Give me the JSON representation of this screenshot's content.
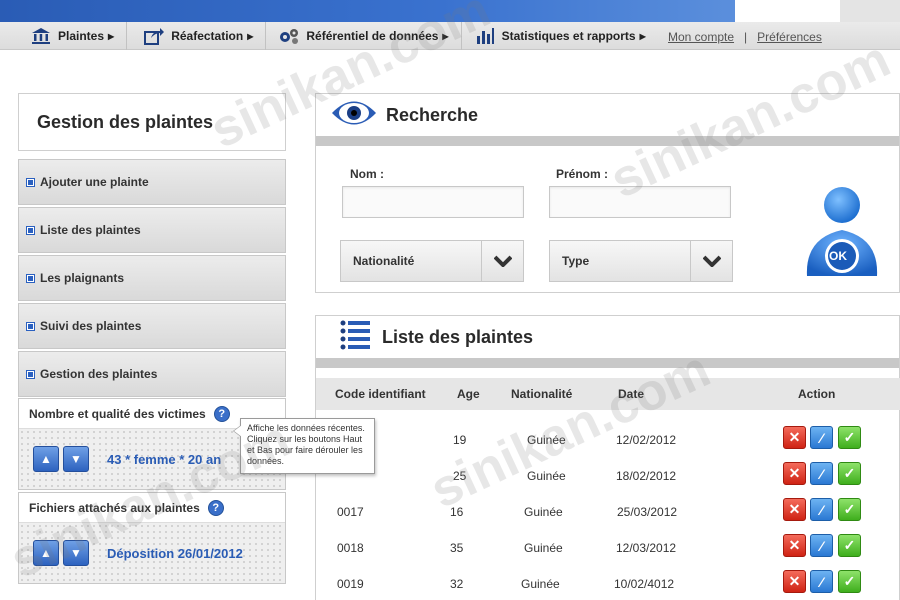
{
  "nav": {
    "menu": [
      {
        "label": "Plaintes",
        "icon": "bank-icon"
      },
      {
        "label": "Réafectation",
        "icon": "share-arrow-icon"
      },
      {
        "label": "Référentiel de données",
        "icon": "gears-icon"
      },
      {
        "label": "Statistiques et rapports",
        "icon": "bar-chart-icon"
      }
    ],
    "account_link": "Mon compte",
    "separator": "|",
    "preferences_link": "Préférences"
  },
  "sidebar": {
    "title": "Gestion des plaintes",
    "items": [
      {
        "label": "Ajouter une plainte"
      },
      {
        "label": "Liste des plaintes"
      },
      {
        "label": "Les plaignants"
      },
      {
        "label": "Suivi des plaintes"
      },
      {
        "label": "Gestion des plaintes"
      }
    ],
    "victims": {
      "title": "Nombre et qualité des victimes",
      "value": "43 * femme * 20 an"
    },
    "files": {
      "title": "Fichiers attachés aux plaintes",
      "value": "Déposition 26/01/2012"
    }
  },
  "tooltip": {
    "text": "Affiche les données récentes. Cliquez sur les boutons Haut et Bas pour faire dérouler les données."
  },
  "search": {
    "title": "Recherche",
    "nom_label": "Nom :",
    "prenom_label": "Prénom :",
    "nom_value": "",
    "prenom_value": "",
    "nationalite_select": "Nationalité",
    "type_select": "Type",
    "ok_button": "OK"
  },
  "list": {
    "title": "Liste des plaintes",
    "columns": [
      "Code identifiant",
      "Age",
      "Nationalité",
      "Date",
      "Action"
    ],
    "rows": [
      {
        "code": "",
        "age": "19",
        "nationalite": "Guinée",
        "date": "12/02/2012"
      },
      {
        "code": "",
        "age": "25",
        "nationalite": "Guinée",
        "date": "18/02/2012"
      },
      {
        "code": "0017",
        "age": "16",
        "nationalite": "Guinée",
        "date": "25/03/2012"
      },
      {
        "code": "0018",
        "age": "35",
        "nationalite": "Guinée",
        "date": "12/03/2012"
      },
      {
        "code": "0019",
        "age": "32",
        "nationalite": "Guinée",
        "date": "10/02/4012"
      }
    ]
  },
  "watermark": "sinikan.com",
  "colors": {
    "accent": "#2a5cb5",
    "delete": "#cf2314",
    "edit": "#2a78d3",
    "validate": "#3fae1d"
  }
}
